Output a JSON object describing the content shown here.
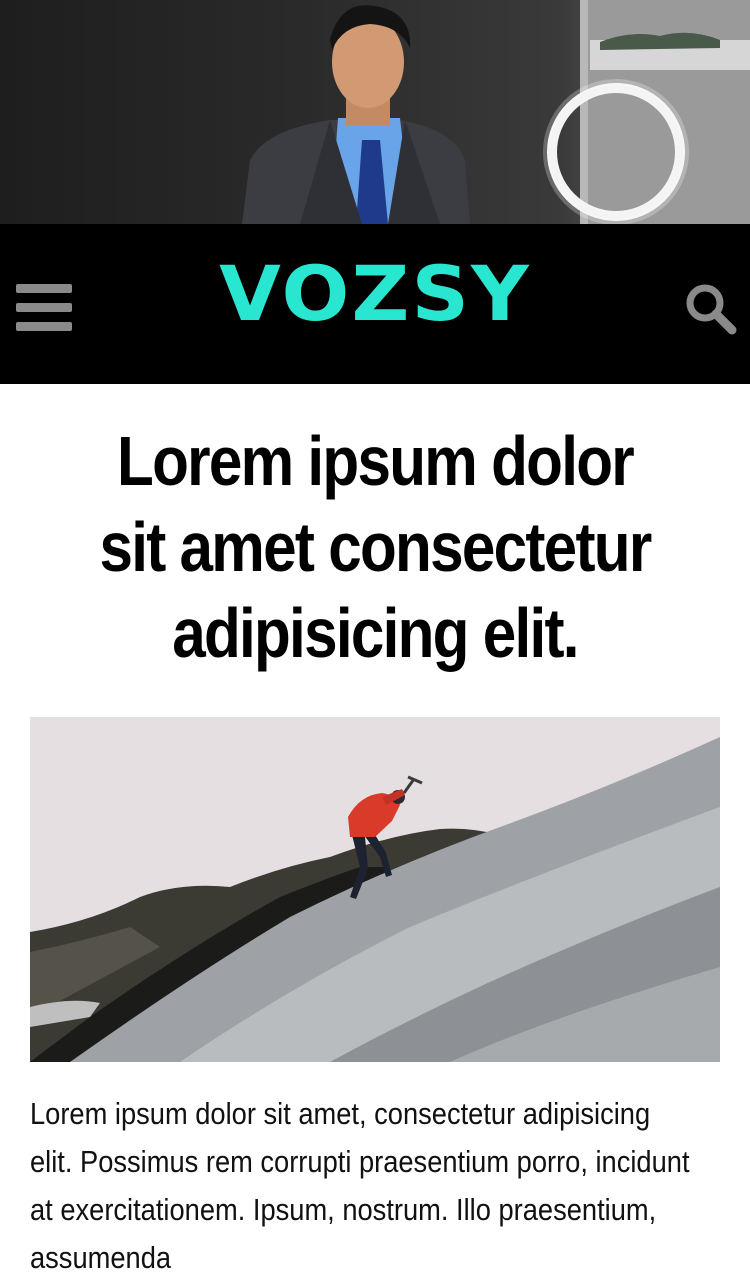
{
  "header": {
    "logo_text": "VOZSY",
    "menu_icon": "hamburger-menu-icon",
    "search_icon": "search-icon",
    "accent_color": "#29e6d0",
    "background_color": "#000000",
    "icon_color": "#8a8a8a"
  },
  "article": {
    "title": "Lorem ipsum dolor sit amet consectetur adipisicing elit.",
    "body": "Lorem ipsum dolor sit amet, consectetur adipisicing elit. Possimus rem corrupti praesentium porro, incidunt at exercitationem. Ipsum, nostrum. Illo praesentium, assumenda"
  }
}
